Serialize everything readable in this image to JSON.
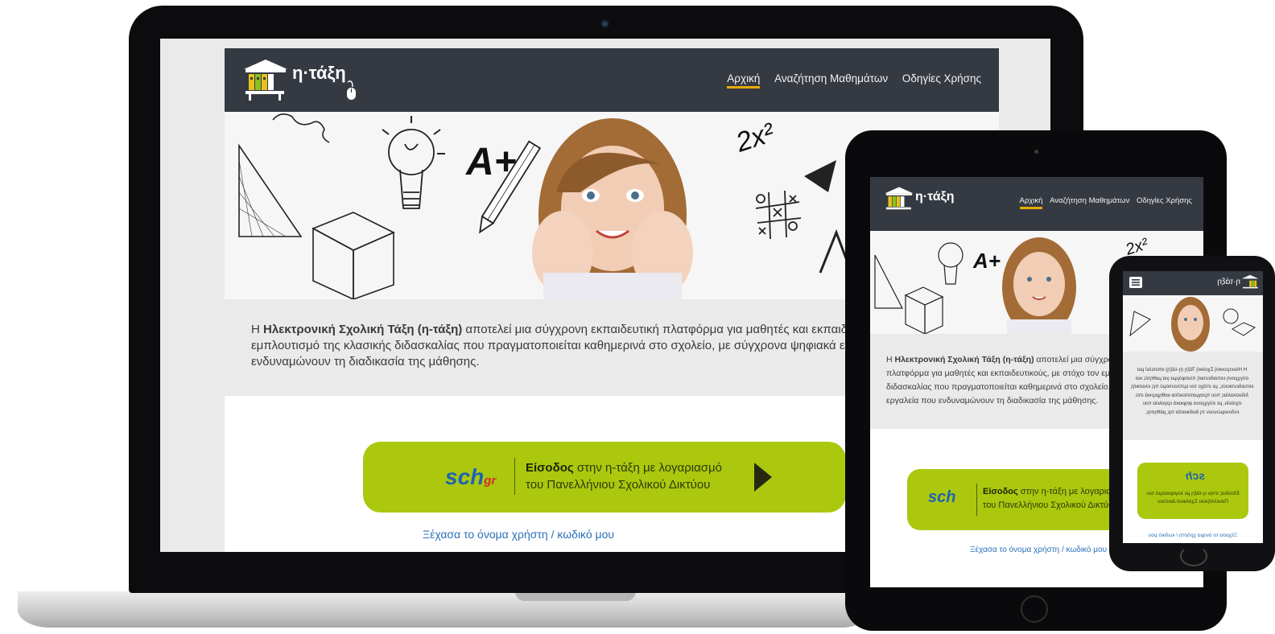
{
  "site": {
    "brand": "η·τάξη",
    "nav": [
      {
        "label": "Αρχική",
        "active": true
      },
      {
        "label": "Αναζήτηση Μαθημάτων",
        "active": false
      },
      {
        "label": "Οδηγίες Χρήσης",
        "active": false
      }
    ],
    "hero_text": {
      "a_plus": "A+",
      "formula": "2x²"
    },
    "intro": {
      "prefix": "Η ",
      "bold": "Ηλεκτρονική Σχολική Τάξη (η-τάξη)",
      "laptop_line1": " αποτελεί μια σύγχρονη εκπαιδευτική πλατφόρμα για μαθητές και εκπαιδευτικούς, με στόχο τον",
      "laptop_line2": "εμπλουτισμό της κλασικής διδασκαλίας που πραγματοποιείται καθημερινά στο σχολείο, με σύγχρονα ψηφιακά εργαλεία που",
      "laptop_line3": "ενδυναμώνουν τη διαδικασία της μάθησης.",
      "tablet_line1": " αποτελεί μια σύγχρονη εκπαιδευτική",
      "tablet_line2": "πλατφόρμα για μαθητές και εκπαιδευτικούς, με στόχο τον εμπλουτισμό της κλασικής",
      "tablet_line3": "διδασκαλίας που πραγματοποιείται καθημερινά στο σχολείο, με σύγχρονα ψηφιακά",
      "tablet_line4": "εργαλεία που ενδυναμώνουν τη διαδικασία της μάθησης."
    },
    "login": {
      "logo": "sch",
      "logo_suffix": "gr",
      "bold": "Είσοδος",
      "line1_rest": " στην η-τάξη με λογαριασμό",
      "line2": "του Πανελλήνιου Σχολικού Δικτύου"
    },
    "forgot": "Ξέχασα το όνομα χρήστη / κωδικό μου"
  },
  "phone": {
    "brand": "η·τάξη",
    "intro_lines": [
      "Η Ηλεκτρονική Σχολική Τάξη (η-τάξη) αποτελεί μια",
      "σύγχρονη εκπαιδευτική πλατφόρμα για μαθητές και",
      "εκπαιδευτικούς, με στόχο τον εμπλουτισμό της κλασικής",
      "διδασκαλίας που πραγματοποιείται καθημερινά στο",
      "σχολείο, με σύγχρονα ψηφιακά εργαλεία που",
      "ενδυναμώνουν τη διαδικασία της μάθησης."
    ],
    "login_line1": "Είσοδος στην η-τάξη με λογαριασμό του",
    "login_line2": "Πανελλήνιου Σχολικού Δικτύου",
    "forgot": "Ξέχασα το όνομα χρήστη / κωδικό μου"
  },
  "colors": {
    "header": "#353a42",
    "accent": "#e8ab00",
    "login_green": "#abc80e",
    "link": "#2a70b8"
  }
}
